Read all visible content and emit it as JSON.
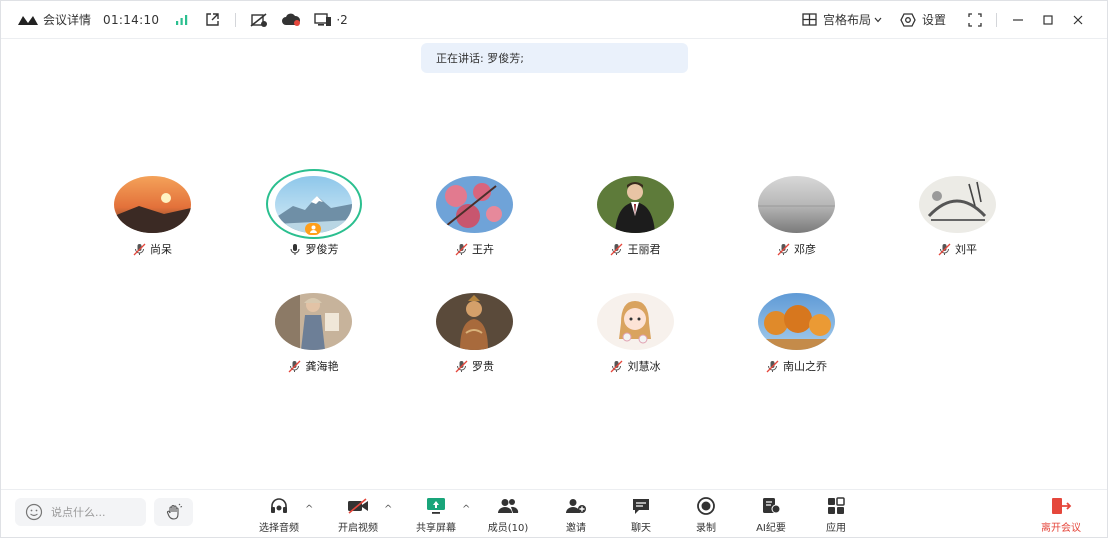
{
  "topbar": {
    "meeting_details": "会议详情",
    "timer": "01:14:10",
    "device_count": "2",
    "layout_label": "宫格布局",
    "settings_label": "设置"
  },
  "speaking": {
    "text": "正在讲话: 罗俊芳;"
  },
  "participants": [
    {
      "name": "尚呆",
      "muted": true
    },
    {
      "name": "罗俊芳",
      "muted": false,
      "speaking": true,
      "host": true
    },
    {
      "name": "王卉",
      "muted": true
    },
    {
      "name": "王丽君",
      "muted": true
    },
    {
      "name": "邓彦",
      "muted": true
    },
    {
      "name": "刘平",
      "muted": true
    },
    {
      "name": "龚海艳",
      "muted": true
    },
    {
      "name": "罗贵",
      "muted": true
    },
    {
      "name": "刘慧冰",
      "muted": true
    },
    {
      "name": "南山之乔",
      "muted": true
    }
  ],
  "bottombar": {
    "say_placeholder": "说点什么...",
    "audio": "选择音频",
    "video": "开启视频",
    "share": "共享屏幕",
    "members": "成员(10)",
    "invite": "邀请",
    "chat": "聊天",
    "record": "录制",
    "ai_minutes": "AI纪要",
    "apps": "应用",
    "leave": "离开会议"
  },
  "colors": {
    "accent_green": "#2bbf8f",
    "host_orange": "#ff9f1a",
    "leave_red": "#e5473c",
    "banner_bg": "#eaf1fb"
  }
}
